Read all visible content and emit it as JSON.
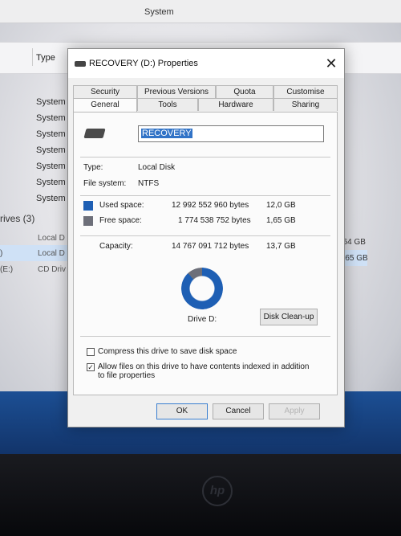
{
  "explorer": {
    "title": "System",
    "column_type": "Type",
    "system_rows": [
      "System",
      "System",
      "System",
      "System",
      "System",
      "System",
      "System"
    ],
    "drives_heading": "rives (3)",
    "drive_rows": [
      {
        "side": "",
        "name": "Local D",
        "size": "864 GB"
      },
      {
        "side": ")",
        "name": "Local D",
        "size": "1,65 GB"
      },
      {
        "side": "(E:)",
        "name": "CD Driv",
        "size": ""
      }
    ]
  },
  "dialog": {
    "title": "RECOVERY (D:) Properties",
    "close_glyph": "✕",
    "tabs_row1": [
      "Security",
      "Previous Versions",
      "Quota",
      "Customise"
    ],
    "tabs_row2": [
      "General",
      "Tools",
      "Hardware",
      "Sharing"
    ],
    "active_tab": "General",
    "drive_name": "RECOVERY",
    "type_label": "Type:",
    "type_value": "Local Disk",
    "fs_label": "File system:",
    "fs_value": "NTFS",
    "used": {
      "label": "Used space:",
      "bytes": "12 992 552 960 bytes",
      "size": "12,0 GB",
      "color": "#1e5fb4"
    },
    "free": {
      "label": "Free space:",
      "bytes": "1 774 538 752 bytes",
      "size": "1,65 GB",
      "color": "#6d6f79"
    },
    "capacity": {
      "label": "Capacity:",
      "bytes": "14 767 091 712 bytes",
      "size": "13,7 GB"
    },
    "usage_fraction": 0.88,
    "donut_label": "Drive D:",
    "cleanup_button": "Disk Clean-up",
    "compress": {
      "label": "Compress this drive to save disk space",
      "checked": false
    },
    "index": {
      "label": "Allow files on this drive to have contents indexed in addition to file properties",
      "checked": true
    },
    "ok_button": "OK",
    "cancel_button": "Cancel",
    "apply_button": "Apply"
  },
  "colors": {
    "accent": "#3173c7",
    "taskbar": "#1c4f94"
  }
}
